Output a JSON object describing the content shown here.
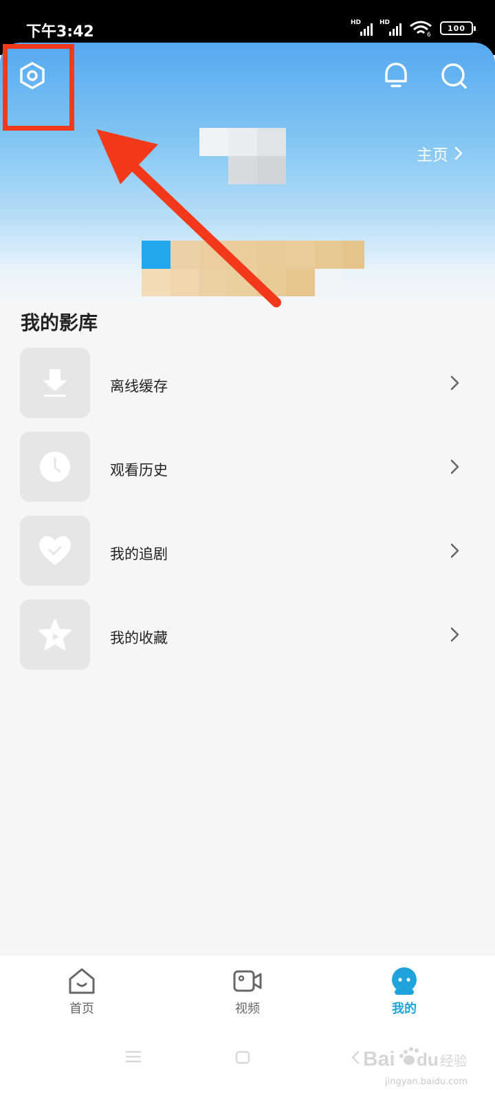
{
  "status_bar": {
    "time": "下午3:42",
    "sim1": "HD",
    "sim2": "HD",
    "wifi_badge": "6",
    "battery": "100"
  },
  "header": {
    "settings_icon": "hexagon-settings-icon",
    "bell_icon": "bell-icon",
    "search_icon": "search-icon",
    "profile_link": "主页",
    "avatar_obscured": true
  },
  "library": {
    "title": "我的影库",
    "items": [
      {
        "label": "离线缓存",
        "icon": "download-icon"
      },
      {
        "label": "观看历史",
        "icon": "clock-icon"
      },
      {
        "label": "我的追剧",
        "icon": "heart-check-icon"
      },
      {
        "label": "我的收藏",
        "icon": "star-icon"
      }
    ]
  },
  "tab_bar": {
    "tabs": [
      {
        "label": "首页",
        "icon": "home-icon",
        "active": false
      },
      {
        "label": "视频",
        "icon": "video-camera-icon",
        "active": false
      },
      {
        "label": "我的",
        "icon": "profile-icon",
        "active": true
      }
    ]
  },
  "annotation": {
    "color": "#f2391c"
  },
  "watermark": {
    "logo": "Bai du 经验",
    "site": "jingyan.baidu.com"
  },
  "colors": {
    "accent": "#1ea3dd",
    "header_top": "#56a9f0"
  }
}
